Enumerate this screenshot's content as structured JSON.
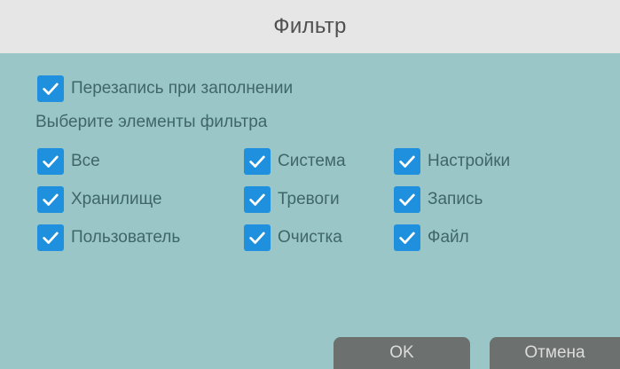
{
  "dialog": {
    "title": "Фильтр",
    "overwrite": {
      "label": "Перезапись при заполнении",
      "checked": true
    },
    "filter_section_label": "Выберите элементы фильтра",
    "filters": [
      {
        "label": "Все",
        "checked": true
      },
      {
        "label": "Система",
        "checked": true
      },
      {
        "label": "Настройки",
        "checked": true
      },
      {
        "label": "Хранилище",
        "checked": true
      },
      {
        "label": "Тревоги",
        "checked": true
      },
      {
        "label": "Запись",
        "checked": true
      },
      {
        "label": "Пользователь",
        "checked": true
      },
      {
        "label": "Очистка",
        "checked": true
      },
      {
        "label": "Файл",
        "checked": true
      }
    ],
    "buttons": {
      "ok": "OK",
      "cancel": "Отмена"
    }
  },
  "colors": {
    "background": "#9ac6c8",
    "title_bar": "#e6e6e6",
    "checkbox": "#1e90dd",
    "button": "#6c706f",
    "label_text": "#3f6668"
  },
  "icons": {
    "checkbox": "checkmark-icon"
  }
}
